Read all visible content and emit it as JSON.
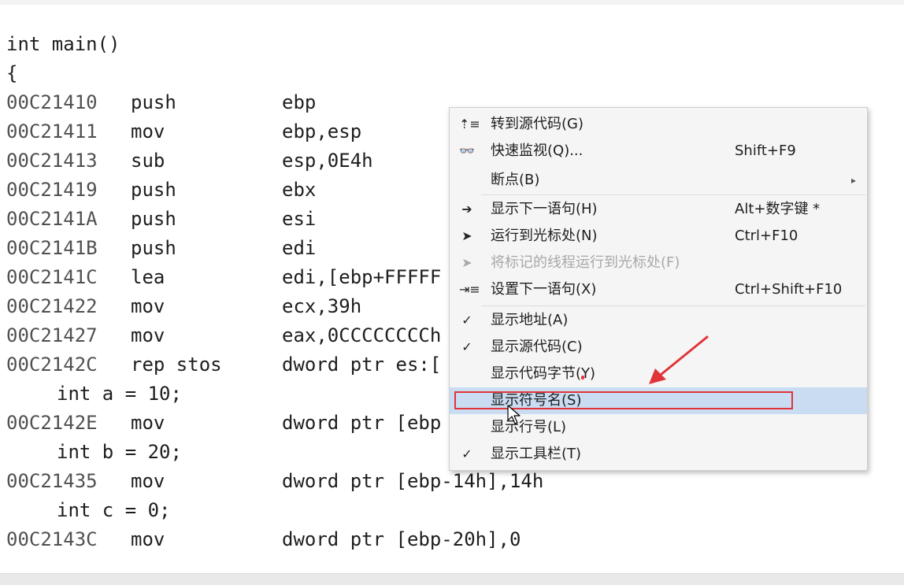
{
  "disassembly": {
    "lines": [
      {
        "kind": "src",
        "text": "int main()"
      },
      {
        "kind": "src",
        "text": "{"
      },
      {
        "kind": "asm",
        "addr": "00C21410",
        "mnemonic": "push",
        "operands": "ebp"
      },
      {
        "kind": "asm",
        "addr": "00C21411",
        "mnemonic": "mov",
        "operands": "ebp,esp"
      },
      {
        "kind": "asm",
        "addr": "00C21413",
        "mnemonic": "sub",
        "operands": "esp,0E4h"
      },
      {
        "kind": "asm",
        "addr": "00C21419",
        "mnemonic": "push",
        "operands": "ebx"
      },
      {
        "kind": "asm",
        "addr": "00C2141A",
        "mnemonic": "push",
        "operands": "esi"
      },
      {
        "kind": "asm",
        "addr": "00C2141B",
        "mnemonic": "push",
        "operands": "edi"
      },
      {
        "kind": "asm",
        "addr": "00C2141C",
        "mnemonic": "lea",
        "operands": "edi,[ebp+FFFFF"
      },
      {
        "kind": "asm",
        "addr": "00C21422",
        "mnemonic": "mov",
        "operands": "ecx,39h"
      },
      {
        "kind": "asm",
        "addr": "00C21427",
        "mnemonic": "mov",
        "operands": "eax,0CCCCCCCCh"
      },
      {
        "kind": "asm",
        "addr": "00C2142C",
        "mnemonic": "rep stos",
        "operands": "dword ptr es:["
      },
      {
        "kind": "src",
        "text": "int a = 10;",
        "indent": true
      },
      {
        "kind": "asm",
        "addr": "00C2142E",
        "mnemonic": "mov",
        "operands": "dword ptr [ebp"
      },
      {
        "kind": "src",
        "text": "int b = 20;",
        "indent": true
      },
      {
        "kind": "asm",
        "addr": "00C21435",
        "mnemonic": "mov",
        "operands": "dword ptr [ebp-14h],14h"
      },
      {
        "kind": "src",
        "text": "int c = 0;",
        "indent": true
      },
      {
        "kind": "asm",
        "addr": "00C2143C",
        "mnemonic": "mov",
        "operands": "dword ptr [ebp-20h],0"
      }
    ]
  },
  "context_menu": {
    "items": [
      {
        "icon": "goto-source-icon",
        "glyph": "⇡≡",
        "label": "转到源代码(G)",
        "shortcut": ""
      },
      {
        "icon": "glasses-icon",
        "glyph": "👓",
        "label": "快速监视(Q)...",
        "shortcut": "Shift+F9"
      },
      {
        "icon": "",
        "glyph": "",
        "label": "断点(B)",
        "shortcut": "",
        "submenu": true
      },
      {
        "icon": "arrow-right-icon",
        "glyph": "➔",
        "label": "显示下一语句(H)",
        "shortcut": "Alt+数字键 *"
      },
      {
        "icon": "cursor-icon",
        "glyph": "➤",
        "label": "运行到光标处(N)",
        "shortcut": "Ctrl+F10"
      },
      {
        "icon": "cursor-icon",
        "glyph": "➤",
        "label": "将标记的线程运行到光标处(F)",
        "shortcut": "",
        "disabled": true
      },
      {
        "icon": "set-next-statement-icon",
        "glyph": "⇥≡",
        "label": "设置下一语句(X)",
        "shortcut": "Ctrl+Shift+F10"
      },
      {
        "icon": "check-icon",
        "glyph": "✓",
        "label": "显示地址(A)",
        "shortcut": ""
      },
      {
        "icon": "check-icon",
        "glyph": "✓",
        "label": "显示源代码(C)",
        "shortcut": ""
      },
      {
        "icon": "",
        "glyph": "",
        "label": "显示代码字节(Y)",
        "shortcut": ""
      },
      {
        "icon": "",
        "glyph": "",
        "label": "显示符号名(S)",
        "shortcut": "",
        "highlighted": true
      },
      {
        "icon": "",
        "glyph": "",
        "label": "显示行号(L)",
        "shortcut": ""
      },
      {
        "icon": "check-icon",
        "glyph": "✓",
        "label": "显示工具栏(T)",
        "shortcut": ""
      }
    ],
    "submenu_glyph": "▸",
    "highlight_color": "#c9dcf1",
    "annotation_color": "#e0343a"
  }
}
